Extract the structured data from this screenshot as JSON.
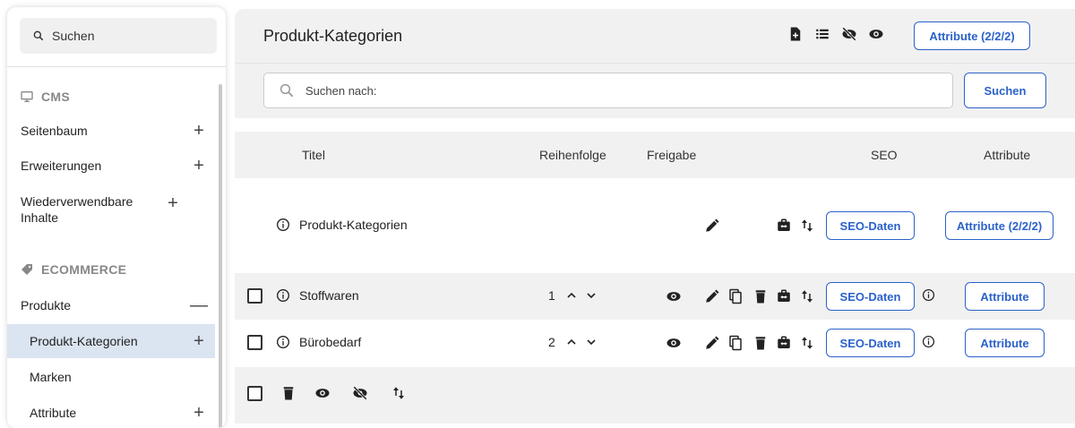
{
  "sidebar": {
    "search_label": "Suchen",
    "sections": [
      {
        "icon": "monitor-icon",
        "label": "CMS"
      },
      {
        "icon": "tag-icon",
        "label": "ECOMMERCE"
      }
    ],
    "items": [
      {
        "label": "Seitenbaum",
        "toggle": "+"
      },
      {
        "label": "Erweiterungen",
        "toggle": "+"
      },
      {
        "label": "Wiederverwendbare Inhalte",
        "toggle": "+"
      },
      {
        "label": "Produkte",
        "toggle": "—"
      },
      {
        "label": "Produkt-Kategorien",
        "toggle": "+",
        "active": true
      },
      {
        "label": "Marken",
        "toggle": ""
      },
      {
        "label": "Attribute",
        "toggle": "+"
      }
    ]
  },
  "header": {
    "title": "Produkt-Kategorien",
    "icons": [
      "add-document-icon",
      "list-icon",
      "eye-off-icon",
      "eye-icon"
    ],
    "attribute_button": "Attribute (2/2/2)"
  },
  "search": {
    "placeholder": "Suchen nach:",
    "button": "Suchen"
  },
  "table": {
    "columns": [
      "Titel",
      "Reihenfolge",
      "Freigabe",
      "SEO",
      "Attribute"
    ],
    "root": {
      "title": "Produkt-Kategorien",
      "seo_button": "SEO-Daten",
      "attribute_button": "Attribute (2/2/2)"
    },
    "rows": [
      {
        "title": "Stoffwaren",
        "order": "1",
        "seo_button": "SEO-Daten",
        "attribute_button": "Attribute"
      },
      {
        "title": "Bürobedarf",
        "order": "2",
        "seo_button": "SEO-Daten",
        "attribute_button": "Attribute"
      }
    ]
  },
  "colors": {
    "accent": "#2c62c9",
    "panel": "#f1f1f1",
    "active": "#dbe4f1"
  }
}
